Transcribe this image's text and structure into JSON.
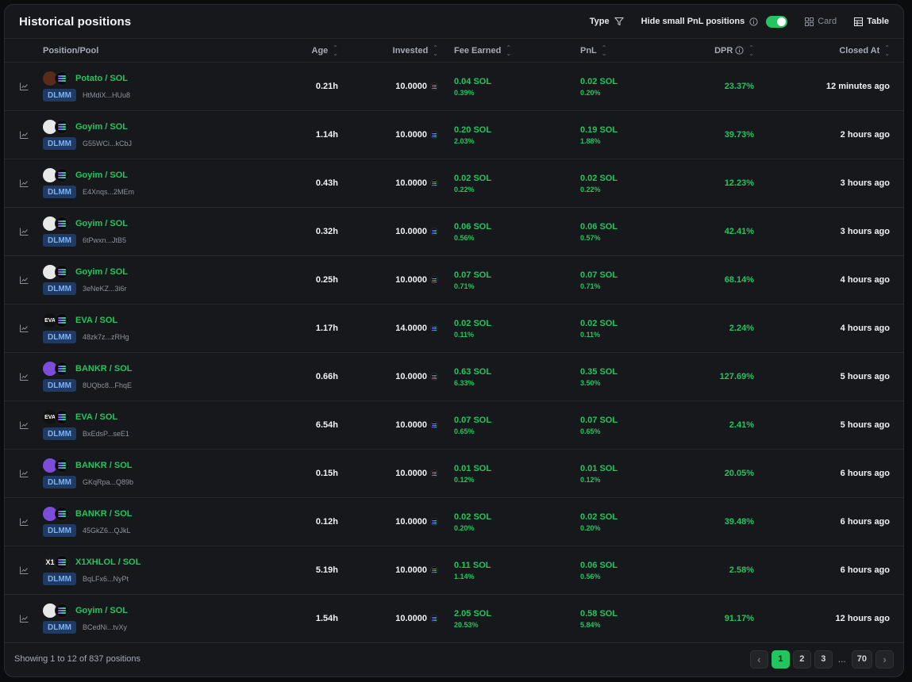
{
  "header": {
    "title": "Historical positions",
    "type_label": "Type",
    "hide_small_label": "Hide small PnL positions",
    "hide_small_enabled": true,
    "card_label": "Card",
    "table_label": "Table",
    "active_view": "Table"
  },
  "columns": {
    "position": "Position/Pool",
    "age": "Age",
    "invested": "Invested",
    "fee": "Fee Earned",
    "pnl": "PnL",
    "dpr": "DPR",
    "closed": "Closed At"
  },
  "rows": [
    {
      "token": "potato",
      "token_glyph": "",
      "pair": "Potato / SOL",
      "badge": "DLMM",
      "address": "HtMdiX...HUu8",
      "age": "0.21h",
      "invested": "10.0000",
      "fee": "0.04 SOL",
      "fee_pct": "0.39%",
      "pnl": "0.02 SOL",
      "pnl_pct": "0.20%",
      "dpr": "23.37%",
      "closed": "12 minutes ago"
    },
    {
      "token": "goyim",
      "token_glyph": "",
      "pair": "Goyim / SOL",
      "badge": "DLMM",
      "address": "G55WCi...kCbJ",
      "age": "1.14h",
      "invested": "10.0000",
      "fee": "0.20 SOL",
      "fee_pct": "2.03%",
      "pnl": "0.19 SOL",
      "pnl_pct": "1.88%",
      "dpr": "39.73%",
      "closed": "2 hours ago"
    },
    {
      "token": "goyim",
      "token_glyph": "",
      "pair": "Goyim / SOL",
      "badge": "DLMM",
      "address": "E4Xnqs...2MEm",
      "age": "0.43h",
      "invested": "10.0000",
      "fee": "0.02 SOL",
      "fee_pct": "0.22%",
      "pnl": "0.02 SOL",
      "pnl_pct": "0.22%",
      "dpr": "12.23%",
      "closed": "3 hours ago"
    },
    {
      "token": "goyim",
      "token_glyph": "",
      "pair": "Goyim / SOL",
      "badge": "DLMM",
      "address": "6tPwxn...JtB5",
      "age": "0.32h",
      "invested": "10.0000",
      "fee": "0.06 SOL",
      "fee_pct": "0.56%",
      "pnl": "0.06 SOL",
      "pnl_pct": "0.57%",
      "dpr": "42.41%",
      "closed": "3 hours ago"
    },
    {
      "token": "goyim",
      "token_glyph": "",
      "pair": "Goyim / SOL",
      "badge": "DLMM",
      "address": "3eNeKZ...3i6r",
      "age": "0.25h",
      "invested": "10.0000",
      "fee": "0.07 SOL",
      "fee_pct": "0.71%",
      "pnl": "0.07 SOL",
      "pnl_pct": "0.71%",
      "dpr": "68.14%",
      "closed": "4 hours ago"
    },
    {
      "token": "eva",
      "token_glyph": "EVA",
      "pair": "EVA / SOL",
      "badge": "DLMM",
      "address": "48zk7z...zRHg",
      "age": "1.17h",
      "invested": "14.0000",
      "fee": "0.02 SOL",
      "fee_pct": "0.11%",
      "pnl": "0.02 SOL",
      "pnl_pct": "0.11%",
      "dpr": "2.24%",
      "closed": "4 hours ago"
    },
    {
      "token": "bankr",
      "token_glyph": "",
      "pair": "BANKR / SOL",
      "badge": "DLMM",
      "address": "8UQbc8...FhqE",
      "age": "0.66h",
      "invested": "10.0000",
      "fee": "0.63 SOL",
      "fee_pct": "6.33%",
      "pnl": "0.35 SOL",
      "pnl_pct": "3.50%",
      "dpr": "127.69%",
      "closed": "5 hours ago"
    },
    {
      "token": "eva",
      "token_glyph": "EVA",
      "pair": "EVA / SOL",
      "badge": "DLMM",
      "address": "BxEdsP...seE1",
      "age": "6.54h",
      "invested": "10.0000",
      "fee": "0.07 SOL",
      "fee_pct": "0.65%",
      "pnl": "0.07 SOL",
      "pnl_pct": "0.65%",
      "dpr": "2.41%",
      "closed": "5 hours ago"
    },
    {
      "token": "bankr",
      "token_glyph": "",
      "pair": "BANKR / SOL",
      "badge": "DLMM",
      "address": "GKqRpa...Q89b",
      "age": "0.15h",
      "invested": "10.0000",
      "fee": "0.01 SOL",
      "fee_pct": "0.12%",
      "pnl": "0.01 SOL",
      "pnl_pct": "0.12%",
      "dpr": "20.05%",
      "closed": "6 hours ago"
    },
    {
      "token": "bankr",
      "token_glyph": "",
      "pair": "BANKR / SOL",
      "badge": "DLMM",
      "address": "45GkZ6...QJkL",
      "age": "0.12h",
      "invested": "10.0000",
      "fee": "0.02 SOL",
      "fee_pct": "0.20%",
      "pnl": "0.02 SOL",
      "pnl_pct": "0.20%",
      "dpr": "39.48%",
      "closed": "6 hours ago"
    },
    {
      "token": "x1",
      "token_glyph": "X1",
      "pair": "X1XHLOL / SOL",
      "badge": "DLMM",
      "address": "BqLFx6...NyPt",
      "age": "5.19h",
      "invested": "10.0000",
      "fee": "0.11 SOL",
      "fee_pct": "1.14%",
      "pnl": "0.06 SOL",
      "pnl_pct": "0.56%",
      "dpr": "2.58%",
      "closed": "6 hours ago"
    },
    {
      "token": "goyim",
      "token_glyph": "",
      "pair": "Goyim / SOL",
      "badge": "DLMM",
      "address": "BCedNi...tvXy",
      "age": "1.54h",
      "invested": "10.0000",
      "fee": "2.05 SOL",
      "fee_pct": "20.53%",
      "pnl": "0.58 SOL",
      "pnl_pct": "5.84%",
      "dpr": "91.17%",
      "closed": "12 hours ago"
    }
  ],
  "footer": {
    "showing": "Showing 1 to 12 of 837 positions",
    "pages": [
      "1",
      "2",
      "3"
    ],
    "ellipsis": "...",
    "last_page": "70",
    "current_page": "1",
    "prev_arrow": "‹",
    "next_arrow": "›"
  },
  "colors": {
    "accent_green": "#22c55e",
    "badge_bg": "#1f3a63",
    "panel_bg": "#17181b"
  }
}
